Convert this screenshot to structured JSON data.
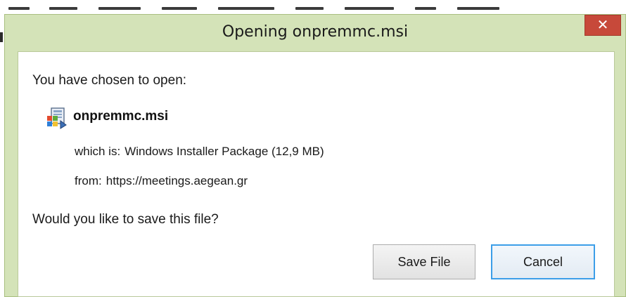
{
  "dialog": {
    "title": "Opening onpremmc.msi",
    "close_glyph": "✕",
    "intro": "You have chosen to open:",
    "file": {
      "name": "onpremmc.msi",
      "icon": "windows-installer-icon"
    },
    "which_is_label": "which is:",
    "which_is_value": "Windows Installer Package (12,9 MB)",
    "from_label": "from:",
    "from_value": "https://meetings.aegean.gr",
    "question": "Would you like to save this file?",
    "buttons": {
      "save": "Save File",
      "cancel": "Cancel"
    }
  },
  "colors": {
    "frame": "#d4e3b8",
    "close": "#c7493a",
    "focus_border": "#3c9ee8"
  }
}
